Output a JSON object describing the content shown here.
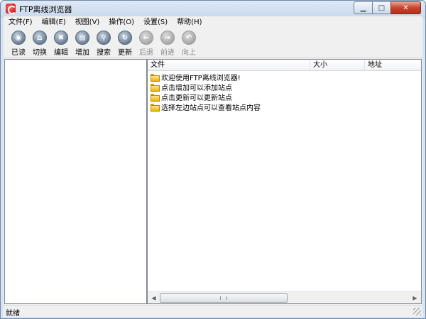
{
  "window": {
    "title": "FTP离线浏览器"
  },
  "menu": [
    {
      "label": "文件(F)"
    },
    {
      "label": "编辑(E)"
    },
    {
      "label": "视图(V)"
    },
    {
      "label": "操作(O)"
    },
    {
      "label": "设置(S)"
    },
    {
      "label": "帮助(H)"
    }
  ],
  "toolbar": [
    {
      "label": "已读",
      "icon": "read-icon",
      "enabled": true
    },
    {
      "label": "切换",
      "icon": "switch-icon",
      "enabled": true
    },
    {
      "label": "编辑",
      "icon": "edit-icon",
      "enabled": true
    },
    {
      "label": "增加",
      "icon": "add-icon",
      "enabled": true
    },
    {
      "label": "搜索",
      "icon": "search-icon",
      "enabled": true
    },
    {
      "label": "更新",
      "icon": "refresh-icon",
      "enabled": true
    },
    {
      "label": "后退",
      "icon": "back-icon",
      "enabled": false
    },
    {
      "label": "前进",
      "icon": "forward-icon",
      "enabled": false
    },
    {
      "label": "向上",
      "icon": "up-icon",
      "enabled": false
    }
  ],
  "list": {
    "columns": [
      "文件",
      "大小",
      "地址"
    ],
    "rows": [
      {
        "name": "欢迎使用FTP离线浏览器!"
      },
      {
        "name": "点击增加可以添加站点"
      },
      {
        "name": "点击更新可以更新站点"
      },
      {
        "name": "选择左边站点可以查看站点内容"
      }
    ]
  },
  "status": {
    "text": "就绪"
  }
}
